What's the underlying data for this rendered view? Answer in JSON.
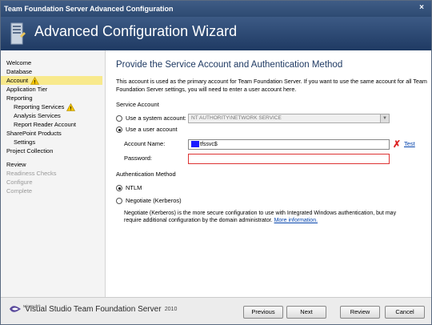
{
  "window": {
    "title": "Team Foundation Server Advanced Configuration",
    "close_label": "×"
  },
  "banner": {
    "title": "Advanced Configuration Wizard",
    "icon": "server-wizard-icon"
  },
  "nav": {
    "items": [
      {
        "label": "Welcome",
        "sub": false,
        "state": "normal"
      },
      {
        "label": "Database",
        "sub": false,
        "state": "normal"
      },
      {
        "label": "Account",
        "sub": false,
        "state": "active",
        "warning": true
      },
      {
        "label": "Application Tier",
        "sub": false,
        "state": "normal"
      },
      {
        "label": "Reporting",
        "sub": false,
        "state": "normal"
      },
      {
        "label": "Reporting Services",
        "sub": true,
        "state": "normal",
        "warning": true
      },
      {
        "label": "Analysis Services",
        "sub": true,
        "state": "normal"
      },
      {
        "label": "Report Reader Account",
        "sub": true,
        "state": "normal"
      },
      {
        "label": "SharePoint Products",
        "sub": false,
        "state": "normal"
      },
      {
        "label": "Settings",
        "sub": true,
        "state": "normal"
      },
      {
        "label": "Project Collection",
        "sub": false,
        "state": "normal"
      }
    ],
    "items2": [
      {
        "label": "Review",
        "sub": false,
        "state": "normal"
      },
      {
        "label": "Readiness Checks",
        "sub": false,
        "state": "disabled"
      },
      {
        "label": "Configure",
        "sub": false,
        "state": "disabled"
      },
      {
        "label": "Complete",
        "sub": false,
        "state": "disabled"
      }
    ]
  },
  "main": {
    "heading": "Provide the Service Account and Authentication Method",
    "description": "This account is used as the primary account for Team Foundation Server. If you want to use the same account for all Team Foundation Server settings, you will need to enter a user account here.",
    "service_account_label": "Service Account",
    "system_account_label": "Use a system account:",
    "system_account_value": "NT AUTHORITY\\NETWORK SERVICE",
    "user_account_label": "Use a user account",
    "account_name_label": "Account Name:",
    "account_name_value": "tfssvc$",
    "password_label": "Password:",
    "password_value": "",
    "test_label": "Test",
    "auth_method_label": "Authentication Method",
    "ntlm_label": "NTLM",
    "kerberos_label": "Negotiate (Kerberos)",
    "kerberos_note": "Negotiate (Kerberos) is the more secure configuration to use with Integrated Windows authentication, but may require additional configuration by the domain administrator.",
    "more_info_label": "More information."
  },
  "footer": {
    "logo_ms": "Microsoft®",
    "logo_product": "Visual Studio Team Foundation Server",
    "logo_year": "2010",
    "previous_label": "Previous",
    "next_label": "Next",
    "review_label": "Review",
    "cancel_label": "Cancel"
  },
  "colors": {
    "banner": "#2d4a72",
    "active_nav": "#f8e98c",
    "error_border": "#dd3333",
    "link": "#0645ad"
  }
}
